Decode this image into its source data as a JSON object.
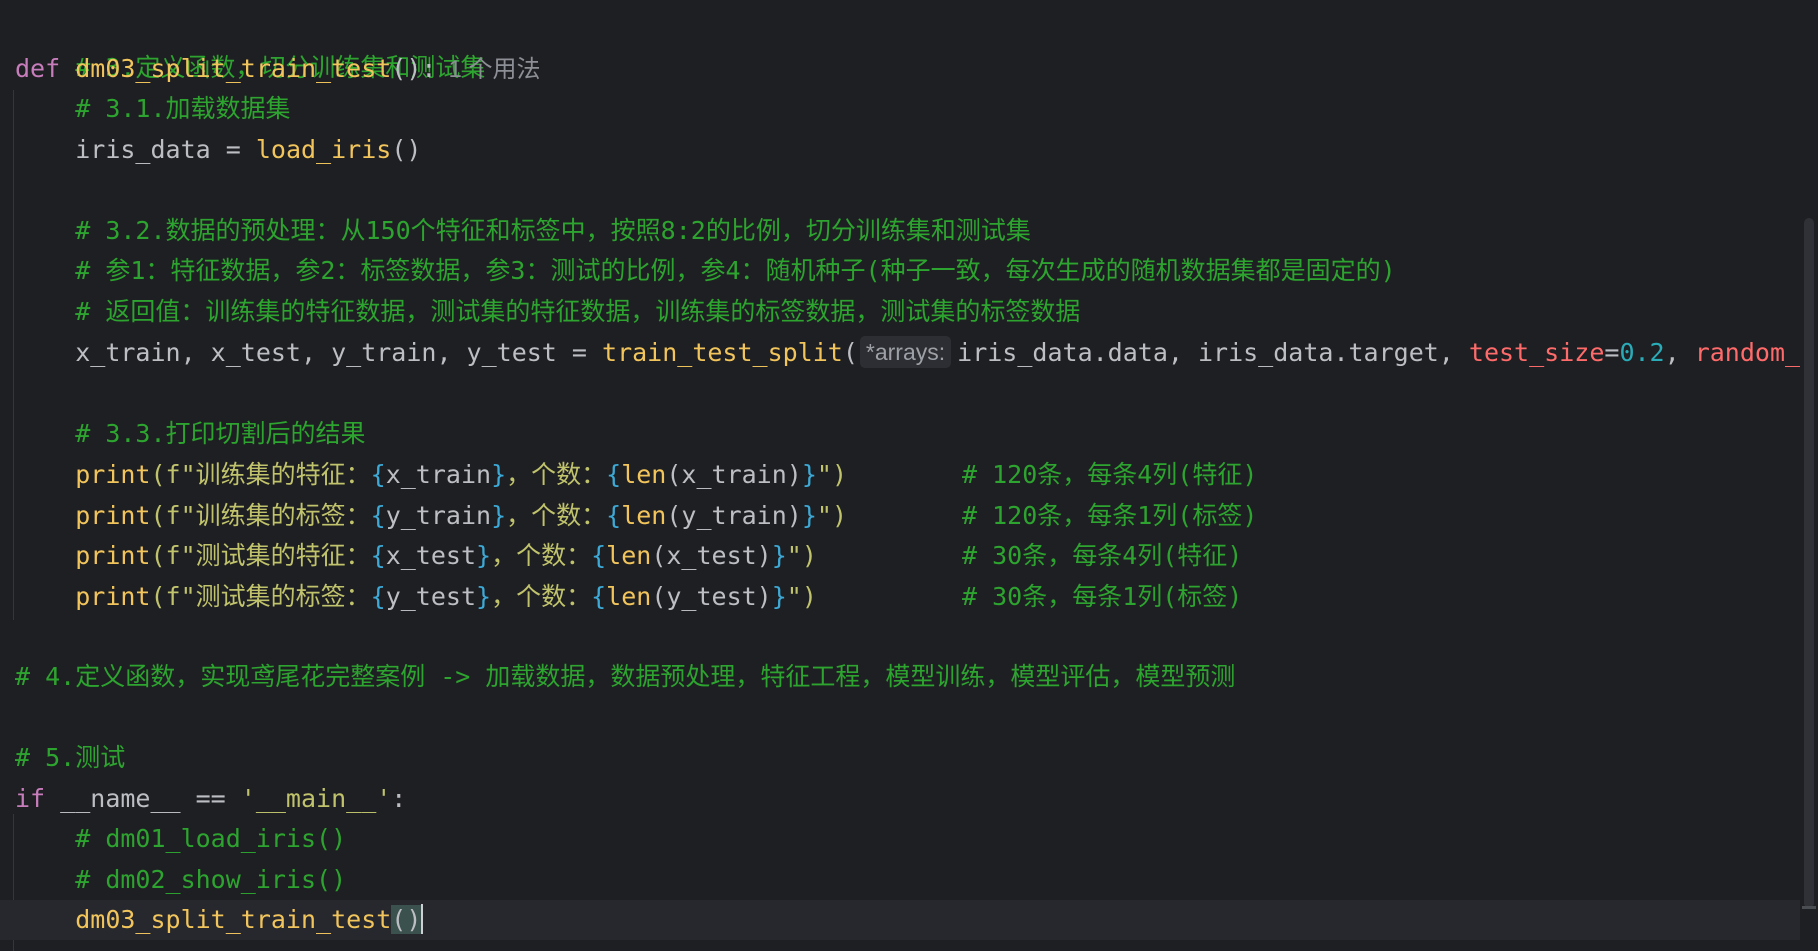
{
  "editor": {
    "lines": {
      "l1": "# 3.定义函数，切分训练集和测试集",
      "l2_def": "def",
      "l2_name": "dm03_split_train_test",
      "l2_paren": "():",
      "l2_hint": "1 个用法",
      "l3": "# 3.1.加载数据集",
      "l4_var": "iris_data = ",
      "l4_call": "load_iris",
      "l4_paren": "()",
      "l6": "# 3.2.数据的预处理：从150个特征和标签中，按照8:2的比例，切分训练集和测试集",
      "l7": "# 参1：特征数据，参2：标签数据，参3：测试的比例，参4：随机种子(种子一致，每次生成的随机数据集都是固定的)",
      "l8": "# 返回值：训练集的特征数据，测试集的特征数据，训练集的标签数据，测试集的标签数据",
      "l9_vars": "x_train, x_test, y_train, y_test = ",
      "l9_call": "train_test_split",
      "l9_open": "(",
      "l9_inlay": "*arrays:",
      "l9_args": "iris_data.data, iris_data.target, ",
      "l9_kw1": "test_size",
      "l9_eq": "=",
      "l9_num": "0.2",
      "l9_sep": ", ",
      "l9_kw2": "random_s",
      "l11": "# 3.3.打印切割后的结果",
      "l12_print": "print",
      "l12_pre": "(f\"训练集的特征：",
      "l12_b1": "{",
      "l12_v1": "x_train",
      "l12_b2": "}",
      "l12_mid": "，个数：",
      "l12_b3": "{",
      "l12_len": "len",
      "l12_arg": "(x_train)",
      "l12_b4": "}",
      "l12_end": "\")",
      "l12_cm": "# 120条，每条4列(特征)",
      "l13_print": "print",
      "l13_pre": "(f\"训练集的标签：",
      "l13_b1": "{",
      "l13_v1": "y_train",
      "l13_b2": "}",
      "l13_mid": "，个数：",
      "l13_b3": "{",
      "l13_len": "len",
      "l13_arg": "(y_train)",
      "l13_b4": "}",
      "l13_end": "\")",
      "l13_cm": "# 120条，每条1列(标签)",
      "l14_print": "print",
      "l14_pre": "(f\"测试集的特征：",
      "l14_b1": "{",
      "l14_v1": "x_test",
      "l14_b2": "}",
      "l14_mid": "，个数：",
      "l14_b3": "{",
      "l14_len": "len",
      "l14_arg": "(x_test)",
      "l14_b4": "}",
      "l14_end": "\")",
      "l14_cm": "# 30条，每条4列(特征)",
      "l15_print": "print",
      "l15_pre": "(f\"测试集的标签：",
      "l15_b1": "{",
      "l15_v1": "y_test",
      "l15_b2": "}",
      "l15_mid": "，个数：",
      "l15_b3": "{",
      "l15_len": "len",
      "l15_arg": "(y_test)",
      "l15_b4": "}",
      "l15_end": "\")",
      "l15_cm": "# 30条，每条1列(标签)",
      "l17": "# 4.定义函数，实现鸢尾花完整案例 -> 加载数据，数据预处理，特征工程，模型训练，模型评估，模型预测",
      "l19": "# 5.测试",
      "l20_if": "if",
      "l20_rest": " __name__ == ",
      "l20_str": "'__main__'",
      "l20_colon": ":",
      "l21": "# dm01_load_iris()",
      "l22": "# dm02_show_iris()",
      "l23_call": "dm03_split_train_test",
      "l23_paren": "()"
    }
  }
}
